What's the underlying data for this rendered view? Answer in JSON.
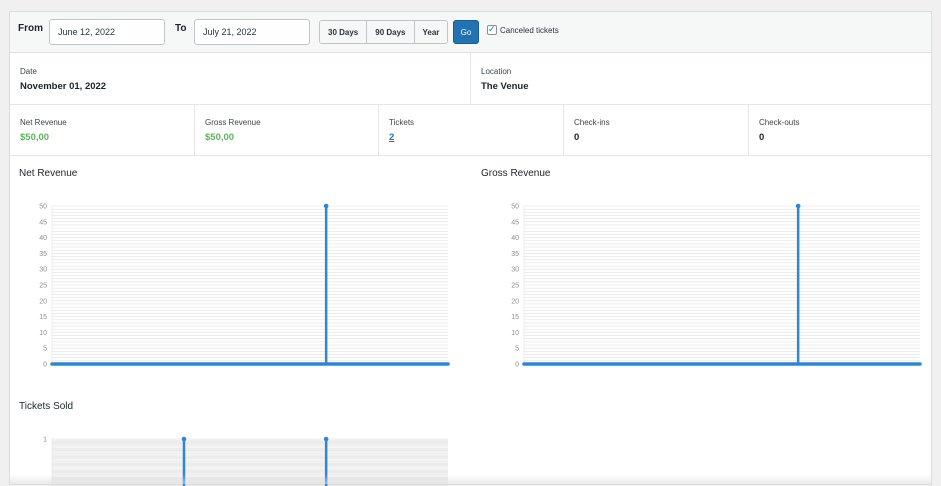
{
  "filters": {
    "from_label": "From",
    "from_value": "June 12, 2022",
    "to_label": "To",
    "to_value": "July 21, 2022",
    "ranges": [
      "30 Days",
      "90 Days",
      "Year"
    ],
    "go_label": "Go",
    "canceled_label": "Canceled tickets",
    "canceled_checked": true
  },
  "event": {
    "date_label": "Date",
    "date_value": "November 01, 2022",
    "location_label": "Location",
    "location_value": "The Venue"
  },
  "stats": [
    {
      "label": "Net Revenue",
      "value": "$50,00"
    },
    {
      "label": "Gross Revenue",
      "value": "$50,00"
    },
    {
      "label": "Tickets",
      "value": "2"
    },
    {
      "label": "Check-ins",
      "value": "0"
    },
    {
      "label": "Check-outs",
      "value": "0"
    }
  ],
  "colors": {
    "accent": "#2271b1",
    "revenue_green": "#5fb35f",
    "series_blue": "#2f86d1"
  },
  "chart_data": [
    {
      "type": "line",
      "title": "Net Revenue",
      "yticks": [
        0,
        5,
        10,
        15,
        20,
        25,
        30,
        35,
        40,
        45,
        50
      ],
      "ylim": [
        0,
        50
      ],
      "x_count": 40,
      "spikes": [
        {
          "index": 27,
          "value": 50
        }
      ],
      "grid": true
    },
    {
      "type": "line",
      "title": "Gross Revenue",
      "yticks": [
        0,
        5,
        10,
        15,
        20,
        25,
        30,
        35,
        40,
        45,
        50
      ],
      "ylim": [
        0,
        50
      ],
      "x_count": 40,
      "spikes": [
        {
          "index": 27,
          "value": 50
        }
      ],
      "grid": true
    },
    {
      "type": "line",
      "title": "Tickets Sold",
      "yticks": [
        1
      ],
      "ylim": [
        0,
        1
      ],
      "x_count": 40,
      "spikes": [
        {
          "index": 13,
          "value": 1
        },
        {
          "index": 27,
          "value": 1
        }
      ],
      "grid": true
    }
  ]
}
